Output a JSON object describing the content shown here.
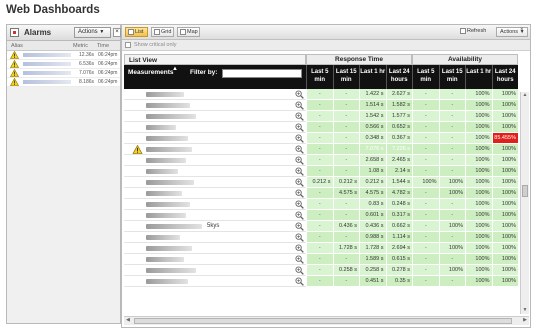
{
  "app": {
    "title": "Web Dashboards"
  },
  "alarms": {
    "title": "Alarms",
    "actions_label": "Actions",
    "columns": {
      "alias": "Alias",
      "metric": "Metric",
      "time": "Time"
    },
    "items": [
      {
        "metric": "12.36s",
        "time": "06:24pm"
      },
      {
        "metric": "6.536s",
        "time": "06:24pm"
      },
      {
        "metric": "7.076s",
        "time": "06:24pm"
      },
      {
        "metric": "8.186s",
        "time": "06:24pm"
      }
    ]
  },
  "toolbar": {
    "list_label": "List",
    "grid_label": "Grid",
    "map_label": "Map",
    "refresh_label": "Refresh",
    "actions_label": "Actions",
    "show_critical_label": "Show critical only"
  },
  "list_view": {
    "title": "List View",
    "group_response": "Response Time",
    "group_availability": "Availability",
    "measurements_label": "Measurements",
    "filter_label": "Filter by:",
    "columns": [
      "Last 5 min",
      "Last 15 min",
      "Last 1 hr",
      "Last 24 hours",
      "Last 5 min",
      "Last 15 min",
      "Last 1 hr",
      "Last 24 hours"
    ],
    "rows": [
      {
        "cells": [
          "-",
          "-",
          "1.422 s",
          "2.627 s",
          "-",
          "-",
          "100%",
          "100%"
        ]
      },
      {
        "cells": [
          "-",
          "-",
          "1.514 s",
          "1.582 s",
          "-",
          "-",
          "100%",
          "100%"
        ]
      },
      {
        "cells": [
          "-",
          "-",
          "1.542 s",
          "1.577 s",
          "-",
          "-",
          "100%",
          "100%"
        ]
      },
      {
        "cells": [
          "-",
          "-",
          "0.566 s",
          "0.652 s",
          "-",
          "-",
          "100%",
          "100%"
        ]
      },
      {
        "cells": [
          "-",
          "-",
          "0.348 s",
          "0.367 s",
          "-",
          "-",
          "100%",
          "85.455%"
        ]
      },
      {
        "cells": [
          "-",
          "-",
          "7.076 s",
          "7.226 s",
          "-",
          "-",
          "100%",
          "100%"
        ]
      },
      {
        "cells": [
          "-",
          "-",
          "2.658 s",
          "2.465 s",
          "-",
          "-",
          "100%",
          "100%"
        ]
      },
      {
        "cells": [
          "-",
          "-",
          "1.08 s",
          "2.14 s",
          "-",
          "-",
          "100%",
          "100%"
        ]
      },
      {
        "cells": [
          "0.212 s",
          "0.212 s",
          "0.212 s",
          "1.544 s",
          "100%",
          "100%",
          "100%",
          "100%"
        ]
      },
      {
        "cells": [
          "-",
          "4.575 s",
          "4.575 s",
          "4.782 s",
          "-",
          "100%",
          "100%",
          "100%"
        ]
      },
      {
        "cells": [
          "-",
          "-",
          "0.83 s",
          "0.248 s",
          "-",
          "-",
          "100%",
          "100%"
        ]
      },
      {
        "cells": [
          "-",
          "-",
          "0.601 s",
          "0.317 s",
          "-",
          "-",
          "100%",
          "100%"
        ]
      },
      {
        "cells": [
          "-",
          "0.436 s",
          "0.436 s",
          "0.662 s",
          "-",
          "100%",
          "100%",
          "100%"
        ],
        "extra": "5kys"
      },
      {
        "cells": [
          "-",
          "-",
          "0.988 s",
          "1.114 s",
          "-",
          "-",
          "100%",
          "100%"
        ]
      },
      {
        "cells": [
          "-",
          "1.728 s",
          "1.728 s",
          "2.694 s",
          "-",
          "100%",
          "100%",
          "100%"
        ]
      },
      {
        "cells": [
          "-",
          "-",
          "1.589 s",
          "0.615 s",
          "-",
          "-",
          "100%",
          "100%"
        ]
      },
      {
        "cells": [
          "-",
          "0.258 s",
          "0.258 s",
          "0.278 s",
          "-",
          "100%",
          "100%",
          "100%"
        ]
      },
      {
        "cells": [
          "-",
          "-",
          "0.451 s",
          "0.35 s",
          "-",
          "-",
          "100%",
          "100%"
        ]
      }
    ]
  },
  "colors": {
    "ok": "#d9f4d0",
    "warning": "#f39b33",
    "critical": "#e0201b",
    "header": "#111111"
  },
  "icons": [
    "warning-icon",
    "zoom-icon",
    "alarm-bell-icon",
    "refresh-icon",
    "close-icon",
    "sort-arrow-icon"
  ]
}
